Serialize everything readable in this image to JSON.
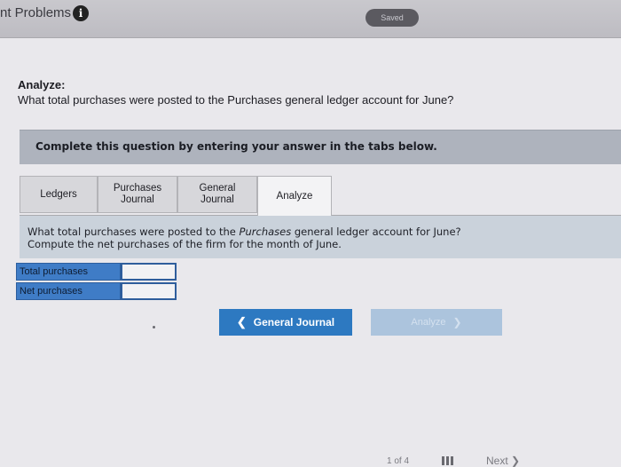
{
  "header": {
    "title": "nt Problems",
    "info_icon": "i",
    "saved": "Saved"
  },
  "analyze": {
    "heading": "Analyze:",
    "question": "What total purchases were posted to the Purchases general ledger account for June?"
  },
  "instruction": "Complete this question by entering your answer in the tabs below.",
  "tabs": [
    {
      "label": "Ledgers"
    },
    {
      "label_line1": "Purchases",
      "label_line2": "Journal"
    },
    {
      "label_line1": "General",
      "label_line2": "Journal"
    },
    {
      "label": "Analyze",
      "active": true
    }
  ],
  "question_box": {
    "line1_pre": "What total purchases were posted to the ",
    "line1_em": "Purchases",
    "line1_post": " general ledger account for June?",
    "line2": "Compute the net purchases of the firm for the month of June."
  },
  "answers": [
    {
      "label": "Total purchases",
      "value": ""
    },
    {
      "label": "Net purchases",
      "value": ""
    }
  ],
  "nav": {
    "prev_label": "General Journal",
    "next_label": "Analyze"
  },
  "footer": {
    "page": "1 of 4",
    "next": "Next"
  },
  "colors": {
    "accent": "#2d79c1",
    "label_fill": "#3f7cc6"
  }
}
